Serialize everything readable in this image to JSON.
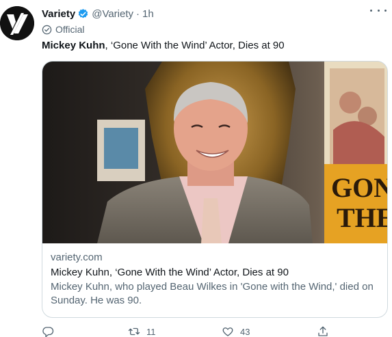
{
  "tweet": {
    "author_name": "Variety",
    "handle": "@Variety",
    "separator": "·",
    "time": "1h",
    "affiliation": "Official",
    "text_bold": "Mickey Kuhn",
    "text_rest": ", ‘Gone With the Wind’ Actor, Dies at 90"
  },
  "card": {
    "domain": "variety.com",
    "title": "Mickey Kuhn, ‘Gone With the Wind’ Actor, Dies at 90",
    "description": "Mickey Kuhn, who played Beau Wilkes in 'Gone with the Wind,' died on Sunday. He was 90.",
    "poster_line1": "GON",
    "poster_line2": "THE"
  },
  "actions": {
    "reply_count": "",
    "retweet_count": "11",
    "like_count": "43"
  },
  "colors": {
    "verified_blue": "#1d9bf0",
    "secondary_text": "#536471",
    "border": "#cfd9de"
  },
  "icons": {
    "avatar": "variety-v-logo",
    "verified": "verified-badge-icon",
    "official": "official-label-icon",
    "more": "more-icon",
    "reply": "reply-icon",
    "retweet": "retweet-icon",
    "like": "like-icon",
    "share": "share-icon"
  }
}
